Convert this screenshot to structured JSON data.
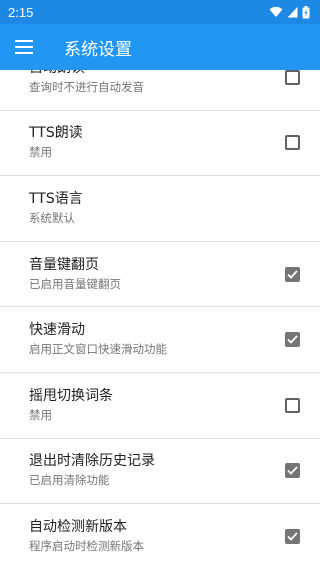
{
  "status_bar": {
    "time": "2:15"
  },
  "app_bar": {
    "title": "系统设置"
  },
  "settings": [
    {
      "title": "自动朗读",
      "subtitle": "查询时不进行自动发音",
      "control": "checkbox",
      "checked": false
    },
    {
      "title": "TTS朗读",
      "subtitle": "禁用",
      "control": "checkbox",
      "checked": false
    },
    {
      "title": "TTS语言",
      "subtitle": "系统默认",
      "control": "none",
      "checked": false
    },
    {
      "title": "音量键翻页",
      "subtitle": "已启用音量键翻页",
      "control": "checkbox",
      "checked": true
    },
    {
      "title": "快速滑动",
      "subtitle": "启用正文窗口快速滑动功能",
      "control": "checkbox",
      "checked": true
    },
    {
      "title": "摇甩切换词条",
      "subtitle": "禁用",
      "control": "checkbox",
      "checked": false
    },
    {
      "title": "退出时清除历史记录",
      "subtitle": "已启用清除功能",
      "control": "checkbox",
      "checked": true
    },
    {
      "title": "自动检测新版本",
      "subtitle": "程序启动时检测新版本",
      "control": "checkbox",
      "checked": true
    }
  ]
}
